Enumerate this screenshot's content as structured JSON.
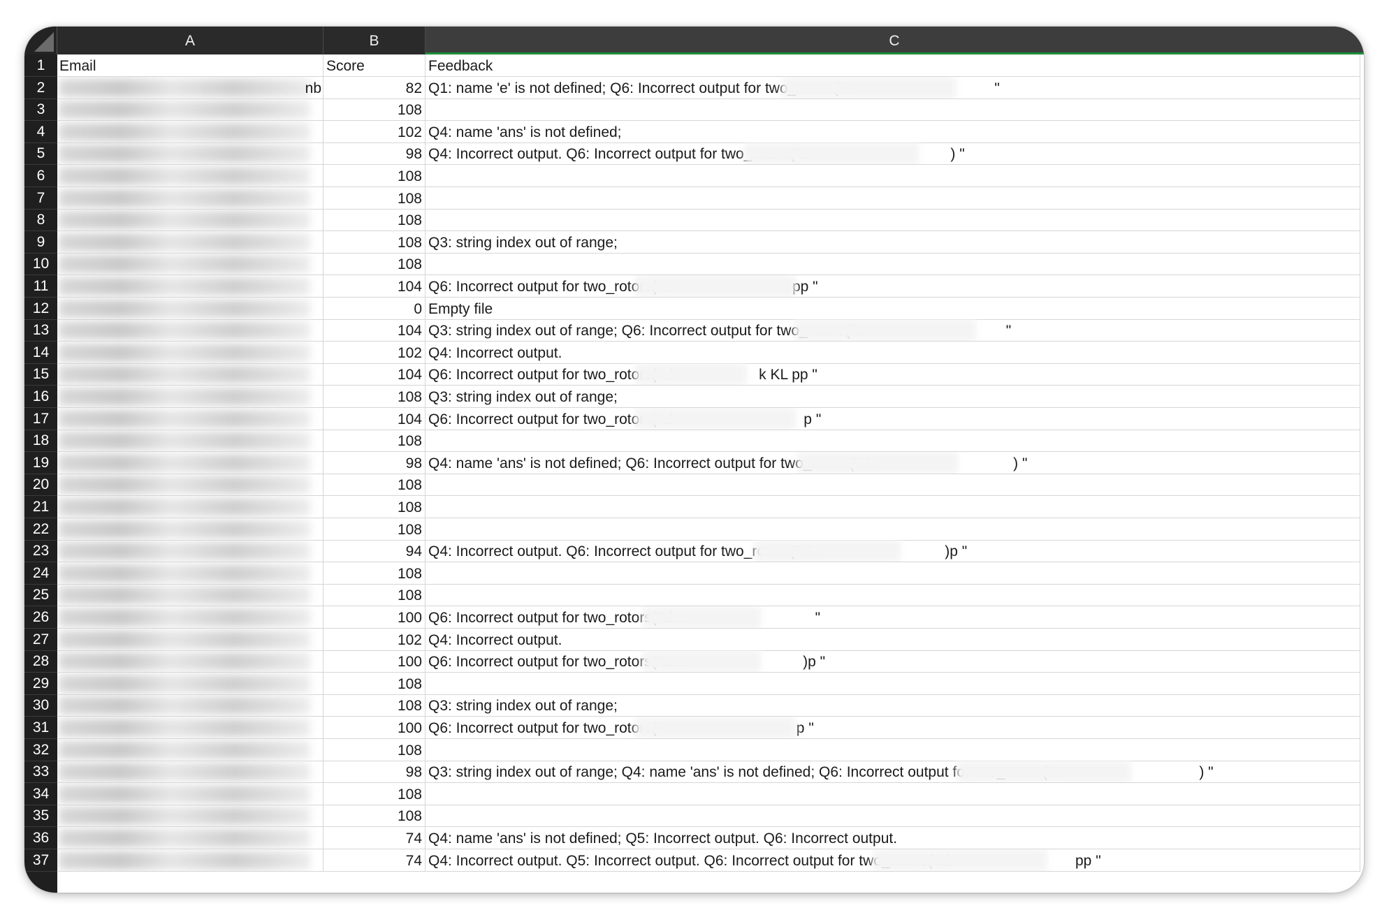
{
  "columns": {
    "a": "A",
    "b": "B",
    "c": "C"
  },
  "rows": [
    {
      "n": "1",
      "email": "Email",
      "score": "Score",
      "feedback": "Feedback"
    },
    {
      "n": "2",
      "email": "nb",
      "score": "82",
      "feedback": "Q1: name 'e' is not defined; Q6: Incorrect output for two_rotors(\"a                                   \""
    },
    {
      "n": "3",
      "email": "",
      "score": "108",
      "feedback": ""
    },
    {
      "n": "4",
      "email": "",
      "score": "102",
      "feedback": "Q4: name 'ans' is not defined;"
    },
    {
      "n": "5",
      "email": "",
      "score": "98",
      "feedback": "Q4: Incorrect output. Q6: Incorrect output for two_rotors(\"a                                   ) \""
    },
    {
      "n": "6",
      "email": "",
      "score": "108",
      "feedback": ""
    },
    {
      "n": "7",
      "email": "",
      "score": "108",
      "feedback": ""
    },
    {
      "n": "8",
      "email": "",
      "score": "108",
      "feedback": ""
    },
    {
      "n": "9",
      "email": "",
      "score": "108",
      "feedback": "Q3: string index out of range;"
    },
    {
      "n": "10",
      "email": "",
      "score": "108",
      "feedback": ""
    },
    {
      "n": "11",
      "email": "",
      "score": "104",
      "feedback": "Q6: Incorrect output for two_rotors(\"a                              pp \""
    },
    {
      "n": "12",
      "email": "",
      "score": "0",
      "feedback": "Empty file"
    },
    {
      "n": "13",
      "email": "",
      "score": "104",
      "feedback": "Q3: string index out of range; Q6: Incorrect output for two_rotors(\"a                                   \""
    },
    {
      "n": "14",
      "email": "",
      "score": "102",
      "feedback": "Q4: Incorrect output."
    },
    {
      "n": "15",
      "email": "",
      "score": "104",
      "feedback": "Q6: Incorrect output for two_rotors(\"ak                    k KL pp \""
    },
    {
      "n": "16",
      "email": "",
      "score": "108",
      "feedback": "Q3: string index out of range;"
    },
    {
      "n": "17",
      "email": "",
      "score": "104",
      "feedback": "Q6: Incorrect output for two_rotors(\"ak                               p \""
    },
    {
      "n": "18",
      "email": "",
      "score": "108",
      "feedback": ""
    },
    {
      "n": "19",
      "email": "",
      "score": "98",
      "feedback": "Q4: name 'ans' is not defined; Q6: Incorrect output for two_rotors(\"ak                                  ) \""
    },
    {
      "n": "20",
      "email": "",
      "score": "108",
      "feedback": ""
    },
    {
      "n": "21",
      "email": "",
      "score": "108",
      "feedback": ""
    },
    {
      "n": "22",
      "email": "",
      "score": "108",
      "feedback": ""
    },
    {
      "n": "23",
      "email": "",
      "score": "94",
      "feedback": "Q4: Incorrect output. Q6: Incorrect output for two_rotors(\"aks                              )p \""
    },
    {
      "n": "24",
      "email": "",
      "score": "108",
      "feedback": ""
    },
    {
      "n": "25",
      "email": "",
      "score": "108",
      "feedback": ""
    },
    {
      "n": "26",
      "email": "",
      "score": "100",
      "feedback": "Q6: Incorrect output for two_rotors(\"aks                                \""
    },
    {
      "n": "27",
      "email": "",
      "score": "102",
      "feedback": "Q4: Incorrect output."
    },
    {
      "n": "28",
      "email": "",
      "score": "100",
      "feedback": "Q6: Incorrect output for two_rotors(\"aks                             )p \""
    },
    {
      "n": "29",
      "email": "",
      "score": "108",
      "feedback": ""
    },
    {
      "n": "30",
      "email": "",
      "score": "108",
      "feedback": "Q3: string index out of range;"
    },
    {
      "n": "31",
      "email": "",
      "score": "100",
      "feedback": "Q6: Incorrect output for two_rotors(\"a                               p \""
    },
    {
      "n": "32",
      "email": "",
      "score": "108",
      "feedback": ""
    },
    {
      "n": "33",
      "email": "",
      "score": "98",
      "feedback": "Q3: string index out of range; Q4: name 'ans' is not defined; Q6: Incorrect output for two_rotors(\"a                                  ) \""
    },
    {
      "n": "34",
      "email": "",
      "score": "108",
      "feedback": ""
    },
    {
      "n": "35",
      "email": "",
      "score": "108",
      "feedback": ""
    },
    {
      "n": "36",
      "email": "",
      "score": "74",
      "feedback": "Q4: name 'ans' is not defined; Q5: Incorrect output. Q6: Incorrect output."
    },
    {
      "n": "37",
      "email": "",
      "score": "74",
      "feedback": "Q4: Incorrect output. Q5: Incorrect output. Q6: Incorrect output for two_rotors(\"ak                              pp \""
    }
  ],
  "colors": {
    "header_bg": "#2a2a2a",
    "row_header_bg": "#1f1f1f",
    "selected_col_bg": "#3d3d3d",
    "selection_accent": "#1b8d3a",
    "gridline": "#d6d6d6"
  }
}
